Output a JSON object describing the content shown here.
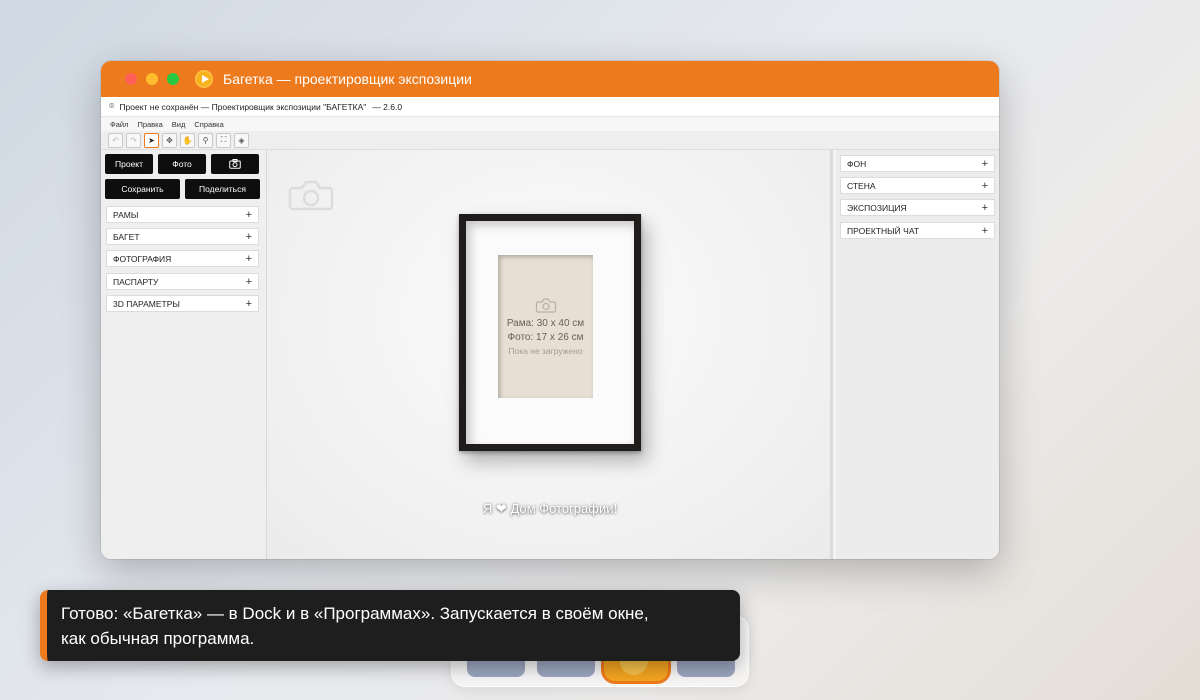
{
  "window": {
    "title": "Багетка — проектировщик экспозиции",
    "subtitle": "Проект не сохранён — Проектировщик экспозиции \"БАГЕТКА\"",
    "version": "— 2.6.0"
  },
  "menu": [
    "Файл",
    "Правка",
    "Вид",
    "Справка"
  ],
  "toolbar": [
    {
      "icon": "undo-icon",
      "glyph": "↶"
    },
    {
      "icon": "redo-icon",
      "glyph": "↷"
    },
    {
      "icon": "pointer-icon",
      "glyph": "➤"
    },
    {
      "icon": "move-icon",
      "glyph": "✥"
    },
    {
      "icon": "hand-icon",
      "glyph": "✋"
    },
    {
      "icon": "zoom-icon",
      "glyph": "⚲"
    },
    {
      "icon": "fit-icon",
      "glyph": "⛶"
    },
    {
      "icon": "layers-icon",
      "glyph": "◈"
    }
  ],
  "left_panel": {
    "project_button": "Проект",
    "photo_button": "Фото",
    "save_button": "Сохранить",
    "share_button": "Поделиться",
    "sections": [
      "РАМЫ",
      "БАГЕТ",
      "ФОТОГРАФИЯ",
      "ПАСПАРТУ",
      "3D ПАРАМЕТРЫ"
    ]
  },
  "canvas": {
    "frame_size": "Рама: 30 x 40 см",
    "photo_size": "Фото: 17 x 26 см",
    "photo_status": "Пока не загружено",
    "tagline_left": "Я",
    "tagline_right": "Дом Фотографии!"
  },
  "right_panel": {
    "sections": [
      "ФОН",
      "СТЕНА",
      "ЭКСПОЗИЦИЯ",
      "ПРОЕКТНЫЙ ЧАТ"
    ]
  },
  "toast": {
    "line1": "Готово: «Багетка» — в Dock и в «Программах». Запускается в своём окне,",
    "line2": "как обычная программа."
  },
  "colors": {
    "accent": "#ee7a1e",
    "titlebar": "#ee7a1e",
    "photo_placeholder": "#e7dfd3",
    "frame": "#1f1c1b"
  }
}
